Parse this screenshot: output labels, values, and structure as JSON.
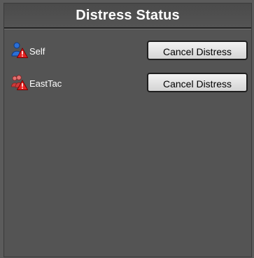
{
  "panel": {
    "title": "Distress Status"
  },
  "distress_list": [
    {
      "icon": "user-distress-icon",
      "label": "Self",
      "button_label": "Cancel Distress"
    },
    {
      "icon": "group-distress-icon",
      "label": "EastTac",
      "button_label": "Cancel Distress"
    }
  ],
  "colors": {
    "background": "#545454",
    "title_text": "#ffffff",
    "warning_red": "#e32020",
    "user_blue": "#2b6fd6",
    "group_red": "#d03a3a"
  }
}
